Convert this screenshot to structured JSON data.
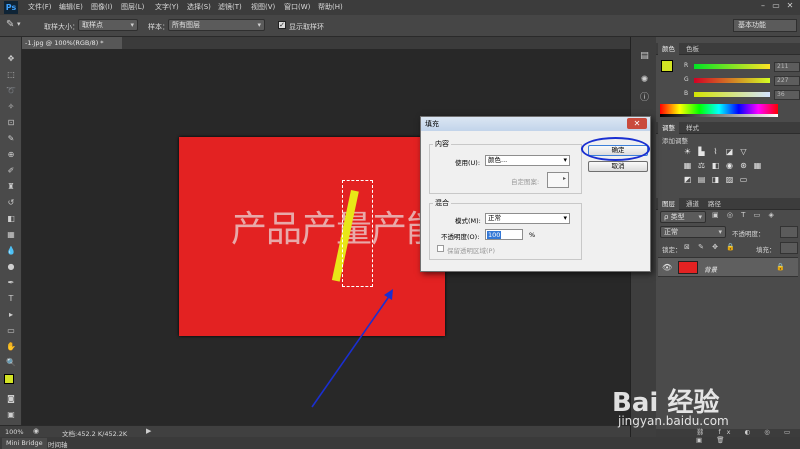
{
  "app": {
    "logo": "Ps"
  },
  "menu": [
    "文件(F)",
    "编辑(E)",
    "图像(I)",
    "图层(L)",
    "文字(Y)",
    "选择(S)",
    "滤镜(T)",
    "视图(V)",
    "窗口(W)",
    "帮助(H)"
  ],
  "options": {
    "sample_size_label": "取样大小：",
    "sample_size_value": "取样点",
    "sample_label": "样本：",
    "sample_value": "所有图层",
    "show_ring_label": "显示取样环",
    "workspace": "基本功能"
  },
  "document": {
    "tab_title": "-1.jpg @ 100%(RGB/8) *",
    "art_text": "产品产量产能"
  },
  "status": {
    "zoom": "100%",
    "doc_info": "文档:452.2 K/452.2K"
  },
  "bottom_tabs": [
    "Mini Bridge",
    "时间轴"
  ],
  "panels": {
    "color_tabs": [
      "颜色",
      "色板"
    ],
    "color": {
      "r_label": "R",
      "r_value": "211",
      "g_label": "G",
      "g_value": "227",
      "b_label": "B",
      "b_value": "36"
    },
    "adjust_tabs": [
      "调整",
      "样式"
    ],
    "adjust_title": "添加调整",
    "layer_tabs": [
      "图层",
      "通道",
      "路径"
    ],
    "layer_kind": "ρ 类型",
    "blend_mode": "正常",
    "opacity_label": "不透明度：",
    "lock_label": "锁定：",
    "fill_label": "填充：",
    "layer_name": "背景"
  },
  "dialog": {
    "title": "填充",
    "close": "✕",
    "content_group": "内容",
    "use_label": "使用(U):",
    "use_value": "颜色...",
    "custom_pattern_label": "自定图案:",
    "blend_group": "混合",
    "mode_label": "模式(M):",
    "mode_value": "正常",
    "opacity_label": "不透明度(O):",
    "opacity_value": "100",
    "opacity_unit": "%",
    "preserve_label": "保留透明区域(P)",
    "ok": "确定",
    "cancel": "取消"
  },
  "watermark": {
    "brand": "Bai 经验",
    "url": "jingyan.baidu.com"
  },
  "colors": {
    "foreground": "#d3e324",
    "canvas_red": "#e32222",
    "annotation_blue": "#1a2fd1"
  }
}
